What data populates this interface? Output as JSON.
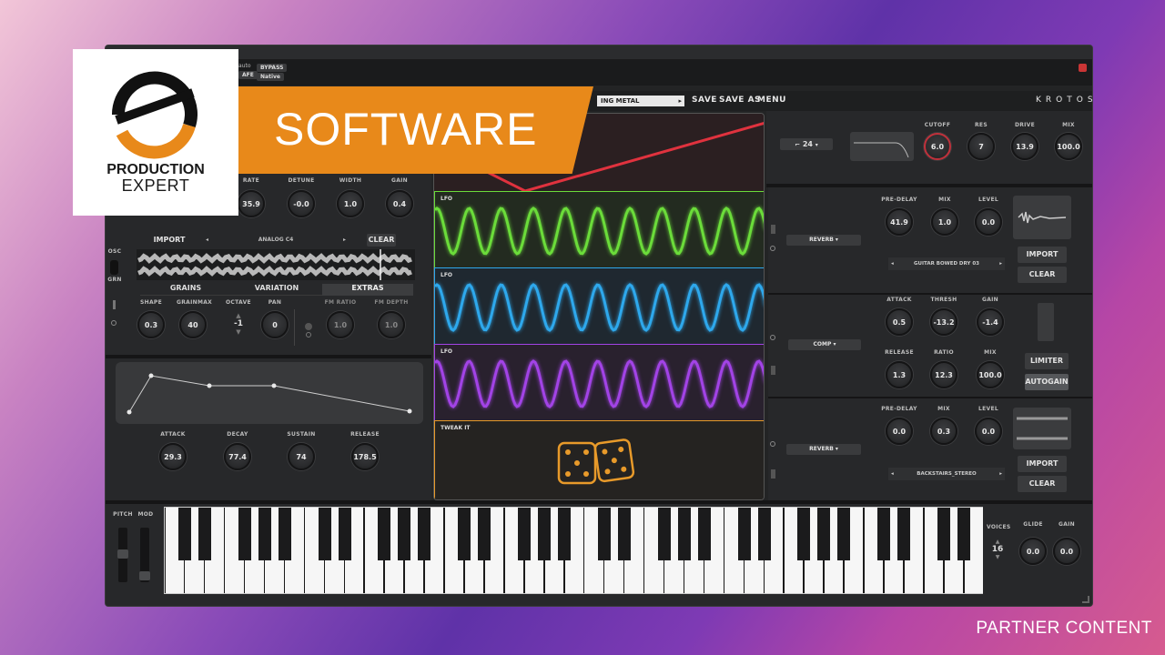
{
  "overlay": {
    "banner": "SOFTWARE",
    "logo_line1": "PRODUCTION",
    "logo_line2": "EXPERT",
    "partner": "PARTNER CONTENT"
  },
  "host": {
    "bypass": "BYPASS",
    "native": "Native",
    "auto": "auto",
    "safe": "AFE"
  },
  "topbar": {
    "preset": "ING METAL",
    "save": "SAVE",
    "save_as": "SAVE AS",
    "menu": "MENU",
    "brand": "KROTOS"
  },
  "filter": {
    "slope": "24",
    "knobs": [
      {
        "label": "CUTOFF",
        "value": "6.0"
      },
      {
        "label": "RES",
        "value": "7"
      },
      {
        "label": "DRIVE",
        "value": "13.9"
      },
      {
        "label": "MIX",
        "value": "100.0"
      }
    ]
  },
  "granular": {
    "knobs_top": [
      {
        "label": "RATE",
        "value": "35.9"
      },
      {
        "label": "DETUNE",
        "value": "-0.0"
      },
      {
        "label": "WIDTH",
        "value": "1.0"
      },
      {
        "label": "GAIN",
        "value": "0.4"
      }
    ],
    "import": "IMPORT",
    "sample": "ANALOG C4",
    "clear": "CLEAR",
    "osc": "OSC",
    "grn": "GRN",
    "tabs": [
      "GRAINS",
      "VARIATION",
      "EXTRAS"
    ],
    "knobs_bottom": [
      {
        "label": "SHAPE",
        "value": "0.3"
      },
      {
        "label": "GRAINMAX",
        "value": "40"
      },
      {
        "label": "OCTAVE",
        "value": "-1"
      },
      {
        "label": "PAN",
        "value": "0"
      },
      {
        "label": "FM RATIO",
        "value": "1.0"
      },
      {
        "label": "FM DEPTH",
        "value": "1.0"
      }
    ]
  },
  "envelope": {
    "knobs": [
      {
        "label": "ATTACK",
        "value": "29.3"
      },
      {
        "label": "DECAY",
        "value": "77.4"
      },
      {
        "label": "SUSTAIN",
        "value": "74"
      },
      {
        "label": "RELEASE",
        "value": "178.5"
      }
    ]
  },
  "mod": {
    "lfo_label": "LFO",
    "tweak": "TWEAK IT",
    "colors": {
      "red": "#e0323e",
      "green": "#6bdc3a",
      "blue": "#2ea8ec",
      "purple": "#a243e6",
      "orange": "#e89a2a"
    }
  },
  "fx": {
    "reverb1": {
      "type": "REVERB",
      "knobs": [
        {
          "label": "PRE-DELAY",
          "value": "41.9"
        },
        {
          "label": "MIX",
          "value": "1.0"
        },
        {
          "label": "LEVEL",
          "value": "0.0"
        }
      ],
      "ir": "GUITAR BOWED DRY 03",
      "import": "IMPORT",
      "clear": "CLEAR"
    },
    "comp": {
      "type": "COMP",
      "knobs_top": [
        {
          "label": "ATTACK",
          "value": "0.5"
        },
        {
          "label": "THRESH",
          "value": "-13.2"
        },
        {
          "label": "GAIN",
          "value": "-1.4"
        }
      ],
      "knobs_bottom": [
        {
          "label": "RELEASE",
          "value": "1.3"
        },
        {
          "label": "RATIO",
          "value": "12.3"
        },
        {
          "label": "MIX",
          "value": "100.0"
        }
      ],
      "limiter": "LIMITER",
      "autogain": "AUTOGAIN"
    },
    "reverb2": {
      "type": "REVERB",
      "knobs": [
        {
          "label": "PRE-DELAY",
          "value": "0.0"
        },
        {
          "label": "MIX",
          "value": "0.3"
        },
        {
          "label": "LEVEL",
          "value": "0.0"
        }
      ],
      "ir": "BACKSTAIRS_STEREO",
      "import": "IMPORT",
      "clear": "CLEAR"
    }
  },
  "keyboard": {
    "pitch": "PITCH",
    "mod": "MOD",
    "voices_label": "VOICES",
    "voices": "16",
    "glide": {
      "label": "GLIDE",
      "value": "0.0"
    },
    "gain": {
      "label": "GAIN",
      "value": "0.0"
    }
  }
}
